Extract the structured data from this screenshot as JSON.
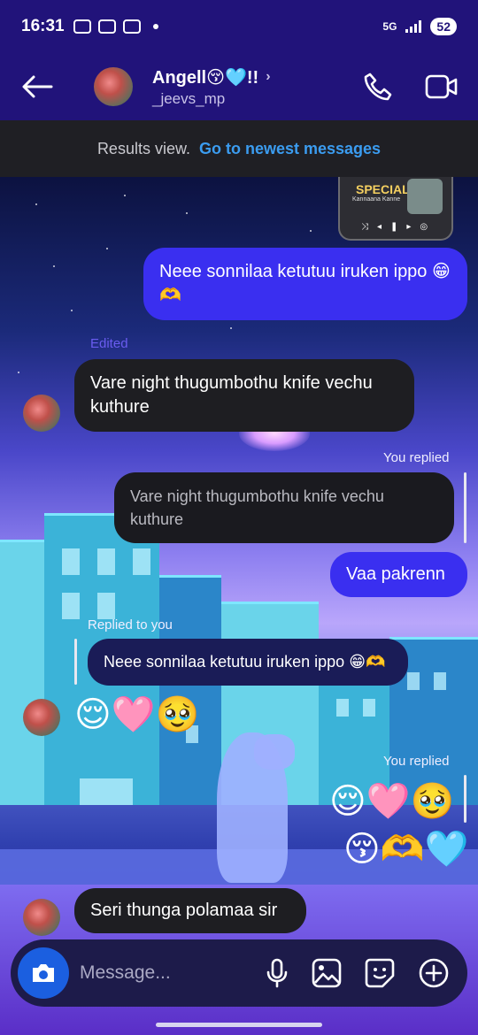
{
  "status_bar": {
    "time": "16:31",
    "network": "5G",
    "battery": "52"
  },
  "header": {
    "name": "Angell😚🩵!!",
    "username": "_jeevs_mp"
  },
  "banner": {
    "text": "Results view.",
    "link": "Go to newest messages"
  },
  "music": {
    "title": "SPECIAL",
    "artist": "Kannaana Kanne"
  },
  "messages": {
    "m1": "Neee sonnilaa ketutuu iruken ippo 😁🫶",
    "edited": "Edited",
    "m2": "Vare night thugumbothu knife vechu kuthure",
    "you_replied_1": "You replied",
    "quote1": "Vare night thugumbothu knife vechu kuthure",
    "m3": "Vaa pakrenn",
    "replied_to_you": "Replied to you",
    "quote2": "Neee sonnilaa ketutuu iruken ippo 😁🫶",
    "emoji_recv": "😌🩷🥹",
    "you_replied_2": "You replied",
    "emoji_sent_1": "😌🩷🥹",
    "emoji_sent_2": "😚🫶🩵",
    "m4": "Seri thunga polamaa sir"
  },
  "composer": {
    "placeholder": "Message..."
  },
  "icons": {
    "back": "back-arrow-icon",
    "call": "phone-icon",
    "video": "video-camera-icon",
    "camera": "camera-icon",
    "mic": "microphone-icon",
    "gallery": "image-icon",
    "sticker": "sticker-icon",
    "more": "plus-circle-icon"
  },
  "colors": {
    "header_bg": "#21137a",
    "sent_bubble": "#3a2ff0",
    "received_bubble": "#1e1e22",
    "link": "#3b9cf0",
    "camera_button": "#1b5fe0"
  }
}
